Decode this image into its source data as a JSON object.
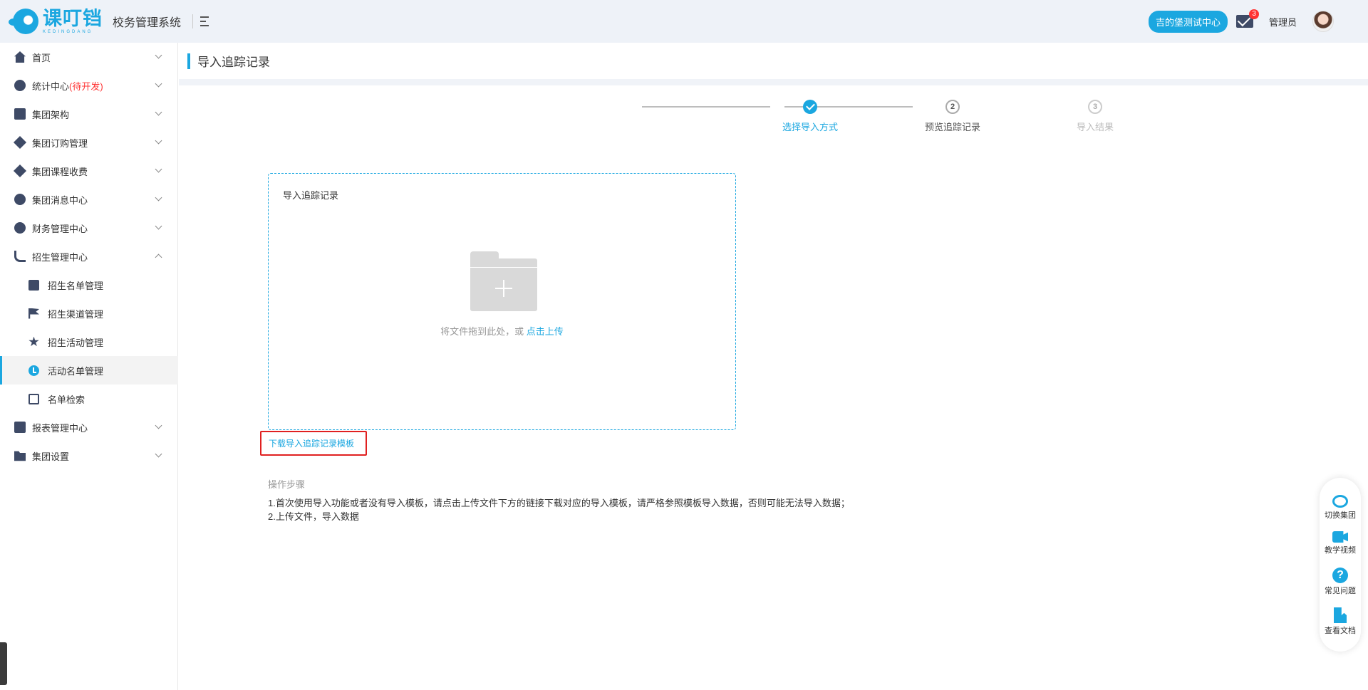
{
  "header": {
    "logo_cn": "课叮铛",
    "logo_en": "KEDINGDANG",
    "system_name": "校务管理系统",
    "campus_button": "吉的堡测试中心",
    "message_count": "3",
    "user_role": "管理员"
  },
  "sidebar": {
    "items": [
      {
        "label": "首页",
        "icon": "home-icon"
      },
      {
        "label": "统计中心",
        "suffix": "(待开发)",
        "icon": "stats-icon"
      },
      {
        "label": "集团架构",
        "icon": "org-icon"
      },
      {
        "label": "集团订购管理",
        "icon": "order-icon"
      },
      {
        "label": "集团课程收费",
        "icon": "course-fee-icon"
      },
      {
        "label": "集团消息中心",
        "icon": "message-center-icon"
      },
      {
        "label": "财务管理中心",
        "icon": "finance-icon"
      },
      {
        "label": "招生管理中心",
        "icon": "enrollment-icon"
      },
      {
        "label": "报表管理中心",
        "icon": "report-icon"
      },
      {
        "label": "集团设置",
        "icon": "settings-folder-icon"
      }
    ],
    "sub_items": [
      {
        "label": "招生名单管理",
        "icon": "list-doc-icon"
      },
      {
        "label": "招生渠道管理",
        "icon": "flag-icon"
      },
      {
        "label": "招生活动管理",
        "icon": "star-icon"
      },
      {
        "label": "活动名单管理",
        "icon": "clock-icon"
      },
      {
        "label": "名单检索",
        "icon": "search-doc-icon"
      }
    ]
  },
  "page": {
    "title": "导入追踪记录"
  },
  "steps": {
    "step1": "选择导入方式",
    "step2_num": "2",
    "step2": "预览追踪记录",
    "step3_num": "3",
    "step3": "导入结果"
  },
  "upload": {
    "title": "导入追踪记录",
    "hint": "将文件拖到此处，或 ",
    "hint_link": "点击上传"
  },
  "download_template": "下载导入追踪记录模板",
  "instructions": {
    "title": "操作步骤",
    "line1": "1.首次使用导入功能或者没有导入模板，请点击上传文件下方的链接下载对应的导入模板，请严格参照模板导入数据，否则可能无法导入数据；",
    "line2": "2.上传文件，导入数据"
  },
  "float_bar": {
    "switch_group": "切换集团",
    "tutorial_video": "教学视频",
    "faq": "常见问题",
    "view_docs": "查看文档"
  },
  "colors": {
    "accent": "#1ba7e0",
    "sidebar_icon": "#3e4a66",
    "highlight_border": "#e02020",
    "pending_text": "#ff3333"
  }
}
